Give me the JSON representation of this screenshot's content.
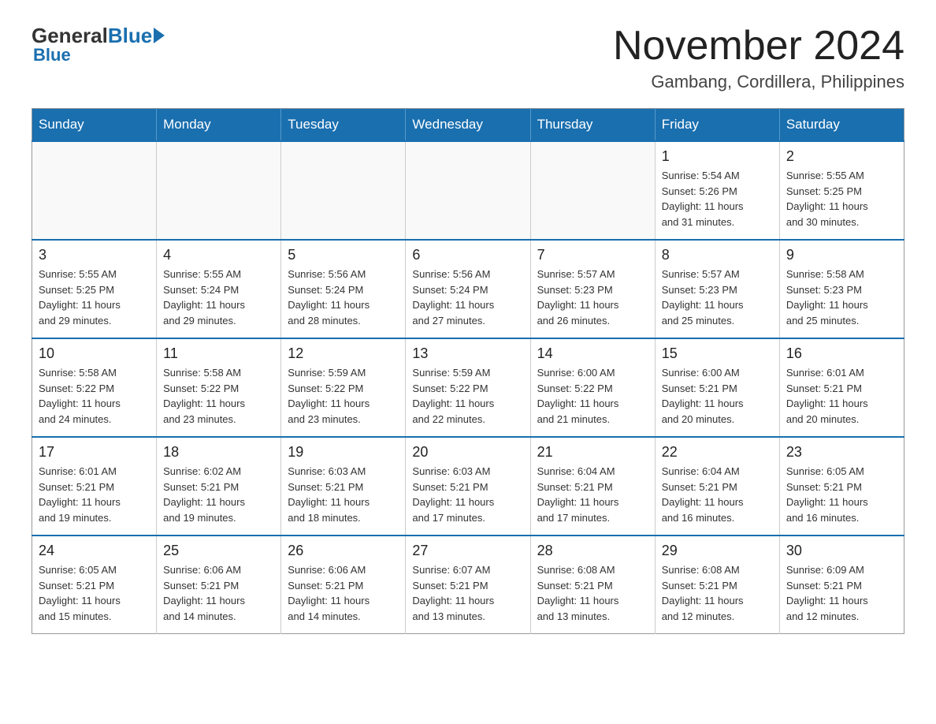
{
  "header": {
    "logo_general": "General",
    "logo_blue": "Blue",
    "title": "November 2024",
    "location": "Gambang, Cordillera, Philippines"
  },
  "calendar": {
    "days_of_week": [
      "Sunday",
      "Monday",
      "Tuesday",
      "Wednesday",
      "Thursday",
      "Friday",
      "Saturday"
    ],
    "weeks": [
      [
        {
          "day": "",
          "info": ""
        },
        {
          "day": "",
          "info": ""
        },
        {
          "day": "",
          "info": ""
        },
        {
          "day": "",
          "info": ""
        },
        {
          "day": "",
          "info": ""
        },
        {
          "day": "1",
          "info": "Sunrise: 5:54 AM\nSunset: 5:26 PM\nDaylight: 11 hours\nand 31 minutes."
        },
        {
          "day": "2",
          "info": "Sunrise: 5:55 AM\nSunset: 5:25 PM\nDaylight: 11 hours\nand 30 minutes."
        }
      ],
      [
        {
          "day": "3",
          "info": "Sunrise: 5:55 AM\nSunset: 5:25 PM\nDaylight: 11 hours\nand 29 minutes."
        },
        {
          "day": "4",
          "info": "Sunrise: 5:55 AM\nSunset: 5:24 PM\nDaylight: 11 hours\nand 29 minutes."
        },
        {
          "day": "5",
          "info": "Sunrise: 5:56 AM\nSunset: 5:24 PM\nDaylight: 11 hours\nand 28 minutes."
        },
        {
          "day": "6",
          "info": "Sunrise: 5:56 AM\nSunset: 5:24 PM\nDaylight: 11 hours\nand 27 minutes."
        },
        {
          "day": "7",
          "info": "Sunrise: 5:57 AM\nSunset: 5:23 PM\nDaylight: 11 hours\nand 26 minutes."
        },
        {
          "day": "8",
          "info": "Sunrise: 5:57 AM\nSunset: 5:23 PM\nDaylight: 11 hours\nand 25 minutes."
        },
        {
          "day": "9",
          "info": "Sunrise: 5:58 AM\nSunset: 5:23 PM\nDaylight: 11 hours\nand 25 minutes."
        }
      ],
      [
        {
          "day": "10",
          "info": "Sunrise: 5:58 AM\nSunset: 5:22 PM\nDaylight: 11 hours\nand 24 minutes."
        },
        {
          "day": "11",
          "info": "Sunrise: 5:58 AM\nSunset: 5:22 PM\nDaylight: 11 hours\nand 23 minutes."
        },
        {
          "day": "12",
          "info": "Sunrise: 5:59 AM\nSunset: 5:22 PM\nDaylight: 11 hours\nand 23 minutes."
        },
        {
          "day": "13",
          "info": "Sunrise: 5:59 AM\nSunset: 5:22 PM\nDaylight: 11 hours\nand 22 minutes."
        },
        {
          "day": "14",
          "info": "Sunrise: 6:00 AM\nSunset: 5:22 PM\nDaylight: 11 hours\nand 21 minutes."
        },
        {
          "day": "15",
          "info": "Sunrise: 6:00 AM\nSunset: 5:21 PM\nDaylight: 11 hours\nand 20 minutes."
        },
        {
          "day": "16",
          "info": "Sunrise: 6:01 AM\nSunset: 5:21 PM\nDaylight: 11 hours\nand 20 minutes."
        }
      ],
      [
        {
          "day": "17",
          "info": "Sunrise: 6:01 AM\nSunset: 5:21 PM\nDaylight: 11 hours\nand 19 minutes."
        },
        {
          "day": "18",
          "info": "Sunrise: 6:02 AM\nSunset: 5:21 PM\nDaylight: 11 hours\nand 19 minutes."
        },
        {
          "day": "19",
          "info": "Sunrise: 6:03 AM\nSunset: 5:21 PM\nDaylight: 11 hours\nand 18 minutes."
        },
        {
          "day": "20",
          "info": "Sunrise: 6:03 AM\nSunset: 5:21 PM\nDaylight: 11 hours\nand 17 minutes."
        },
        {
          "day": "21",
          "info": "Sunrise: 6:04 AM\nSunset: 5:21 PM\nDaylight: 11 hours\nand 17 minutes."
        },
        {
          "day": "22",
          "info": "Sunrise: 6:04 AM\nSunset: 5:21 PM\nDaylight: 11 hours\nand 16 minutes."
        },
        {
          "day": "23",
          "info": "Sunrise: 6:05 AM\nSunset: 5:21 PM\nDaylight: 11 hours\nand 16 minutes."
        }
      ],
      [
        {
          "day": "24",
          "info": "Sunrise: 6:05 AM\nSunset: 5:21 PM\nDaylight: 11 hours\nand 15 minutes."
        },
        {
          "day": "25",
          "info": "Sunrise: 6:06 AM\nSunset: 5:21 PM\nDaylight: 11 hours\nand 14 minutes."
        },
        {
          "day": "26",
          "info": "Sunrise: 6:06 AM\nSunset: 5:21 PM\nDaylight: 11 hours\nand 14 minutes."
        },
        {
          "day": "27",
          "info": "Sunrise: 6:07 AM\nSunset: 5:21 PM\nDaylight: 11 hours\nand 13 minutes."
        },
        {
          "day": "28",
          "info": "Sunrise: 6:08 AM\nSunset: 5:21 PM\nDaylight: 11 hours\nand 13 minutes."
        },
        {
          "day": "29",
          "info": "Sunrise: 6:08 AM\nSunset: 5:21 PM\nDaylight: 11 hours\nand 12 minutes."
        },
        {
          "day": "30",
          "info": "Sunrise: 6:09 AM\nSunset: 5:21 PM\nDaylight: 11 hours\nand 12 minutes."
        }
      ]
    ]
  }
}
